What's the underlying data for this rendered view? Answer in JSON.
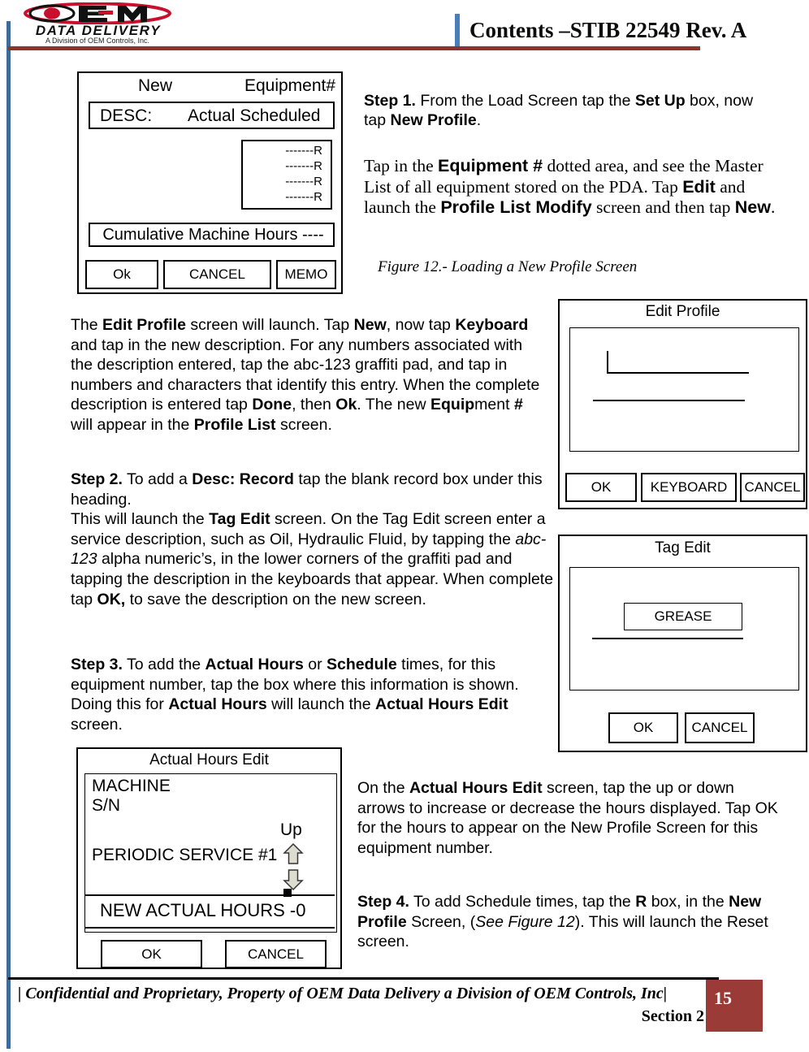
{
  "header": {
    "logo_main": "OEM",
    "logo_secondary": "DATA DELIVERY",
    "logo_tagline": "A Division of OEM Controls, Inc.",
    "title": "Contents –STIB 22549 Rev. A",
    "rule_color": "#8C3330",
    "accent_color": "#4A7EBB"
  },
  "figure_new_profile": {
    "new_label": "New",
    "equipment_label": "Equipment#",
    "desc_label": "DESC:",
    "actual_scheduled": "Actual Scheduled",
    "r_rows": [
      "-------R",
      "-------R",
      "-------R",
      "-------R"
    ],
    "cumulative": "Cumulative Machine Hours ----",
    "buttons": {
      "ok": "Ok",
      "cancel": "CANCEL",
      "memo": "MEMO"
    }
  },
  "step1": {
    "line1_bold": "Step 1.",
    "text": " From the Load Screen tap the ",
    "setup_bold": "Set Up",
    "text2": " box, now tap ",
    "newprofile_bold": "New Profile",
    "text3": "."
  },
  "equipment_paragraph": {
    "t1": "Tap in the ",
    "b1": "Equipment #",
    "t2": " dotted area, and see the Master List of all equipment stored on the PDA. Tap ",
    "b2": "Edit",
    "t3": " and launch the ",
    "b3": "Profile List Modify",
    "t4": " screen and then tap ",
    "b4": "New",
    "t5": "."
  },
  "figure_caption": "Figure 12.- Loading a New Profile Screen",
  "edit_profile_paragraph": {
    "t1": "The ",
    "b1": "Edit Profile",
    "t2": " screen will launch. Tap ",
    "b2": "New",
    "t3": ", now tap ",
    "b3": "Keyboard",
    "t4": " and tap in the new description. For any numbers associated with the description entered, tap the abc-123 graffiti pad, and tap in numbers and characters that identify this entry. When the complete description is entered tap ",
    "b4": "Done",
    "t5": ", then ",
    "b5": "Ok",
    "t6": ".  The new ",
    "b6": "Equip",
    "t7": "ment ",
    "b7": "#",
    "t8": " will appear in the ",
    "b8": "Profile List",
    "t9": " screen."
  },
  "step2_paragraph": {
    "b0": "Step 2.",
    "t1": " To add a ",
    "b1": "Desc: Record",
    "t2": " tap the blank record box under this heading.",
    "t3": "This will launch the ",
    "b2": "Tag Edit",
    "t4": " screen. On the Tag Edit screen enter a service description, such as Oil, Hydraulic Fluid, by tapping the ",
    "i1": "abc-123",
    "t5": " alpha numeric’s, in the lower corners of the graffiti pad and tapping the description in the keyboards that appear. When complete tap ",
    "b3": "OK,",
    "t6": " to save the description on the new screen."
  },
  "step3_paragraph": {
    "b0": "Step 3.",
    "t1": " To add the ",
    "b1": "Actual Hours",
    "t2": " or ",
    "b2": "Schedule",
    "t3": " times, for this equipment number, tap the box where this information is shown. Doing this for ",
    "b3": "Actual Hours",
    "t4": " will launch the ",
    "b4": "Actual Hours Edit",
    "t5": " screen."
  },
  "figure_edit_profile": {
    "title": "Edit Profile",
    "buttons": {
      "ok": "OK",
      "keyboard": "KEYBOARD",
      "cancel": "CANCEL"
    }
  },
  "figure_tag_edit": {
    "title": "Tag Edit",
    "value": "GREASE",
    "buttons": {
      "ok": "OK",
      "cancel": "CANCEL"
    }
  },
  "figure_actual_hours_edit": {
    "title": "Actual Hours Edit",
    "machine": "MACHINE",
    "sn": "S/N",
    "up_label": "Up",
    "periodic_service": "PERIODIC SERVICE #1",
    "new_actual_hours": "NEW ACTUAL HOURS -0",
    "buttons": {
      "ok": "OK",
      "cancel": "CANCEL"
    }
  },
  "actual_hours_paragraph": {
    "t1": "On the ",
    "b1": "Actual Hours Edit",
    "t2": " screen, tap the up or down arrows to increase or decrease the hours displayed. Tap OK for the hours to appear on the New Profile Screen for this equipment number."
  },
  "step4_paragraph": {
    "b0": "Step 4.",
    "t1": " To add Schedule times, tap the ",
    "b1": "R",
    "t2": " box, in the ",
    "b2": "New Profile",
    "t3": " Screen, (",
    "i1": "See Figure 12",
    "t4": "). This will launch the Reset screen."
  },
  "footer": {
    "confidential": "| Confidential and Proprietary, Property of OEM Data Delivery a Division of OEM Controls, Inc|",
    "section": "Section 2",
    "page_number": "15",
    "badge_color": "#9A3B37"
  }
}
